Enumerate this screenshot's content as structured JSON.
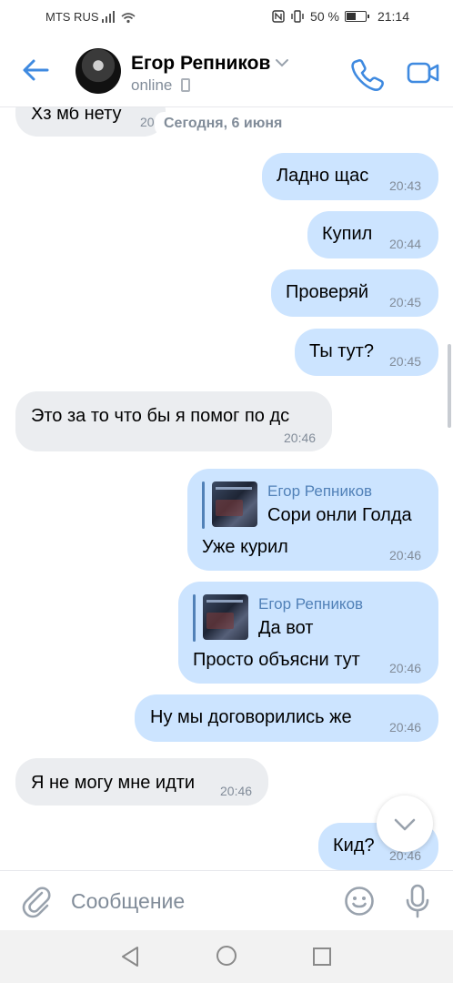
{
  "status_bar": {
    "carrier": "MTS RUS",
    "battery": "50 %",
    "battery_level": 0.5,
    "time": "21:14"
  },
  "header": {
    "name": "Егор Репников",
    "status": "online"
  },
  "date_separator": "Сегодня, 6 июня",
  "messages": [
    {
      "dir": "in",
      "text": "Хз мб нету",
      "time": "20"
    },
    {
      "dir": "out",
      "text": "Ладно щас",
      "time": "20:43"
    },
    {
      "dir": "out",
      "text": "Купил",
      "time": "20:44"
    },
    {
      "dir": "out",
      "text": "Проверяй",
      "time": "20:45"
    },
    {
      "dir": "out",
      "text": "Ты тут?",
      "time": "20:45"
    },
    {
      "dir": "in",
      "text": "Это за то что бы я помог по дс",
      "time": "20:46"
    },
    {
      "dir": "out",
      "reply_name": "Егор Репников",
      "reply_text": "Сори онли Голда",
      "text": "Уже курил",
      "time": "20:46"
    },
    {
      "dir": "out",
      "reply_name": "Егор Репников",
      "reply_text": "Да вот",
      "text": "Просто объясни тут",
      "time": "20:46"
    },
    {
      "dir": "out",
      "text": "Ну мы договорились же",
      "time": "20:46"
    },
    {
      "dir": "in",
      "text": "Я не могу мне идти",
      "time": "20:46"
    },
    {
      "dir": "out",
      "text": "Кид?",
      "time": "20:46"
    }
  ],
  "composer": {
    "placeholder": "Сообщение"
  },
  "icons": {
    "back": "arrow-left-icon",
    "call": "phone-icon",
    "video": "video-camera-icon",
    "attach": "paperclip-icon",
    "emoji": "smile-icon",
    "mic": "microphone-icon",
    "scroll": "chevron-down-icon"
  },
  "colors": {
    "accent": "#3f8ae0",
    "outgoing_bubble": "#cce4ff",
    "incoming_bubble": "#ebedf0",
    "secondary_text": "#818c99"
  }
}
